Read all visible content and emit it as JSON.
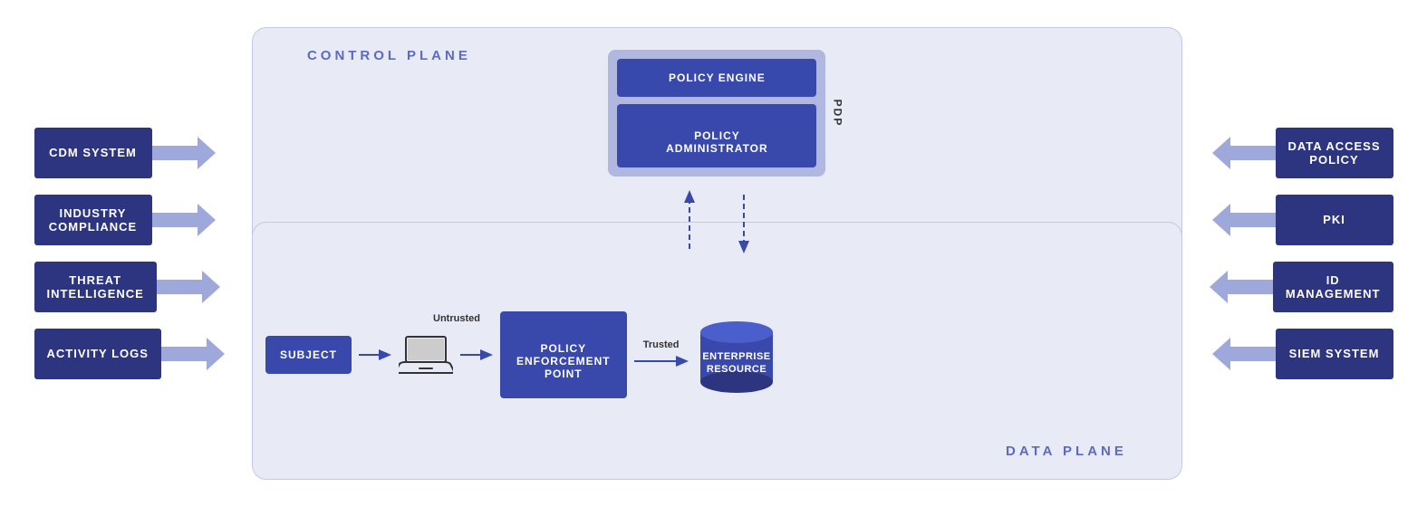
{
  "left_items": [
    {
      "label": "CDM SYSTEM"
    },
    {
      "label": "INDUSTRY\nCOMPLIANCE"
    },
    {
      "label": "THREAT\nINTELLIGENCE"
    },
    {
      "label": "ACTIVITY LOGS"
    }
  ],
  "right_items": [
    {
      "label": "DATA ACCESS\nPOLICY"
    },
    {
      "label": "PKI"
    },
    {
      "label": "ID\nMANAGEMENT"
    },
    {
      "label": "SIEM SYSTEM"
    }
  ],
  "control_plane_label": "CONTROL PLANE",
  "data_plane_label": "DATA PLANE",
  "pdp_label": "PDP",
  "policy_engine_label": "POLICY ENGINE",
  "policy_admin_label": "POLICY\nADMINISTRATOR",
  "subject_label": "SUBJECT",
  "pep_label": "POLICY\nENFORCEMENT\nPOINT",
  "enterprise_resource_label": "ENTERPRISE\nRESOURCE",
  "untrusted_label": "Untrusted",
  "trusted_label": "Trusted",
  "colors": {
    "dark_box": "#2d3580",
    "pdp_box": "#3949ab",
    "control_plane_bg": "#e8eaf6",
    "label_color": "#5c6bc0",
    "arrow_fill": "#9fa8da"
  }
}
